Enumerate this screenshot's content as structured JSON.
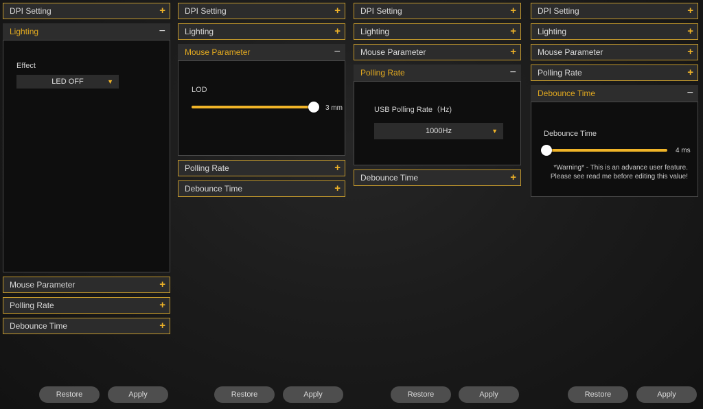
{
  "labels": {
    "dpi": "DPI Setting",
    "lighting": "Lighting",
    "mouse": "Mouse Parameter",
    "polling": "Polling Rate",
    "debounce": "Debounce Time",
    "expand": "+",
    "collapse": "−",
    "restore": "Restore",
    "apply": "Apply"
  },
  "lighting": {
    "effect_label": "Effect",
    "effect_value": "LED OFF",
    "arrow": "▼"
  },
  "mouse": {
    "lod_label": "LOD",
    "lod_value": "3 mm",
    "lod_level_fraction": 1.0
  },
  "polling": {
    "usb_label": "USB Polling Rate（Hz)",
    "value": "1000Hz",
    "arrow": "▼"
  },
  "debounce": {
    "label": "Debounce Time",
    "value": "4 ms",
    "level_fraction": 0.0,
    "warning_line1": "*Warning* - This is an advance user feature.",
    "warning_line2": "Please see read me before editing this value!"
  },
  "colors": {
    "accent": "#f0b428",
    "open_header_text": "#e0a820",
    "border": "#c59a2c"
  }
}
